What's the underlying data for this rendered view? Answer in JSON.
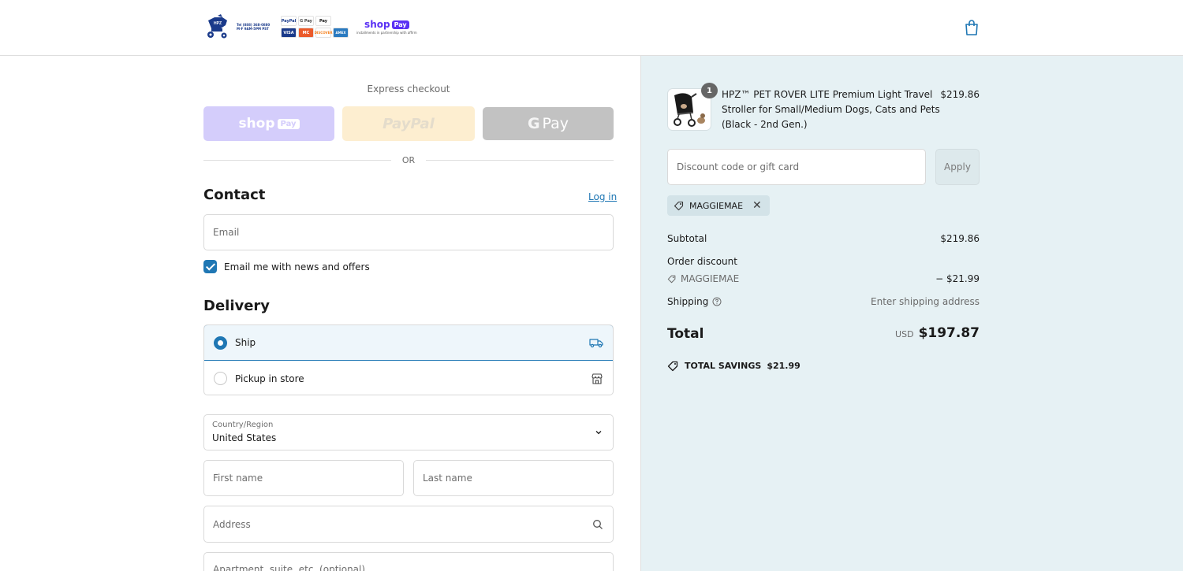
{
  "header": {
    "logo": {
      "brand": "HPZ",
      "contact_line1": "Tel (888) 368-0880",
      "contact_line2": "M-F 9AM-5PM PST"
    },
    "payment_badges": [
      "PayPal",
      "G Pay",
      "Pay",
      "VISA",
      "MC",
      "DISCOVER",
      "AMEX"
    ],
    "shoppay_logo": {
      "text": "shop",
      "pill": "Pay",
      "sub": "installments in partnership with affirm"
    }
  },
  "express": {
    "title": "Express checkout",
    "shop_pay": {
      "text": "shop",
      "pill": "Pay"
    },
    "paypal": "PayPal",
    "gpay": {
      "g": "G",
      "text": "Pay"
    },
    "or": "OR"
  },
  "contact": {
    "heading": "Contact",
    "login": "Log in",
    "email_placeholder": "Email",
    "newsletter_label": "Email me with news and offers",
    "newsletter_checked": true
  },
  "delivery": {
    "heading": "Delivery",
    "options": [
      {
        "label": "Ship",
        "selected": true,
        "icon": "truck-icon"
      },
      {
        "label": "Pickup in store",
        "selected": false,
        "icon": "store-icon"
      }
    ],
    "country_label": "Country/Region",
    "country_value": "United States",
    "first_name_placeholder": "First name",
    "last_name_placeholder": "Last name",
    "address_placeholder": "Address",
    "apartment_placeholder": "Apartment, suite, etc. (optional)"
  },
  "summary": {
    "product": {
      "name": "HPZ™ PET ROVER LITE Premium Light Travel Stroller for Small/Medium Dogs, Cats and Pets (Black - 2nd Gen.)",
      "price": "$219.86",
      "quantity": "1"
    },
    "discount_placeholder": "Discount code or gift card",
    "apply": "Apply",
    "applied_code": "MAGGIEMAE",
    "subtotal_label": "Subtotal",
    "subtotal_value": "$219.86",
    "order_discount_label": "Order discount",
    "discount_code": "MAGGIEMAE",
    "discount_value": "− $21.99",
    "shipping_label": "Shipping",
    "shipping_value": "Enter shipping address",
    "total_label": "Total",
    "currency": "USD",
    "total_value": "$197.87",
    "savings_label": "TOTAL SAVINGS",
    "savings_value": "$21.99"
  },
  "colors": {
    "accent": "#1f77b4",
    "summary_bg": "#e6f1f4",
    "shop_pay": "#5a31f4"
  }
}
